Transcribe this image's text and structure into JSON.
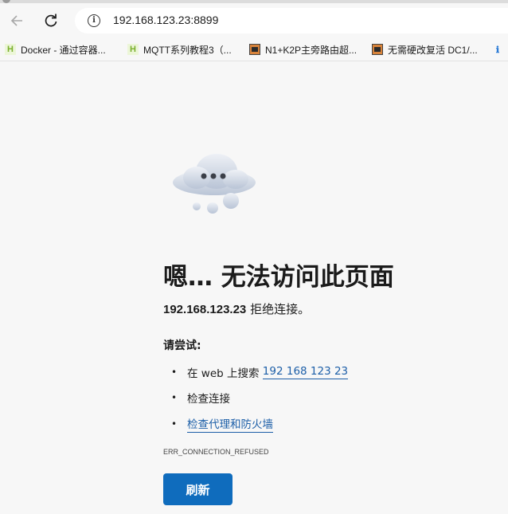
{
  "browser": {
    "url": "192.168.123.23:8899",
    "bookmarks": [
      {
        "label": "Docker - 通过容器...",
        "icon": "hostloc-h-icon"
      },
      {
        "label": "MQTT系列教程3（...",
        "icon": "hostloc-h-icon"
      },
      {
        "label": "N1+K2P主旁路由超...",
        "icon": "site-image-icon"
      },
      {
        "label": "无需硬改复活 DC1/...",
        "icon": "site-image-icon"
      }
    ]
  },
  "error_page": {
    "title": "嗯… 无法访问此页面",
    "host": "192.168.123.23",
    "message": "拒绝连接。",
    "try_label": "请尝试:",
    "suggestions": {
      "search_prefix": "在 web 上搜索",
      "search_link": "192 168 123 23",
      "check_connection": "检查连接",
      "check_proxy": "检查代理和防火墙"
    },
    "error_code": "ERR_CONNECTION_REFUSED",
    "refresh_label": "刷新"
  },
  "colors": {
    "accent": "#0f6cbd",
    "link": "#1d5fa8",
    "background": "#f7f7f7"
  }
}
